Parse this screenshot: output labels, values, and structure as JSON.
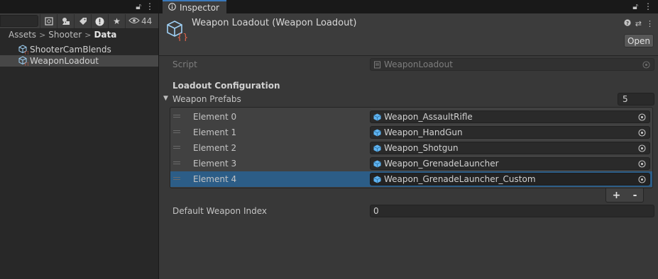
{
  "project": {
    "hidden_count": "44",
    "breadcrumb": [
      "Assets",
      "Shooter",
      "Data"
    ],
    "breadcrumb_sep": ">",
    "files": [
      {
        "name": "ShooterCamBlends",
        "selected": false
      },
      {
        "name": "WeaponLoadout",
        "selected": true
      }
    ]
  },
  "inspector": {
    "tab_label": "Inspector",
    "header_title": "Weapon Loadout (Weapon Loadout)",
    "open_label": "Open",
    "script_label": "Script",
    "script_value": "WeaponLoadout",
    "section_title": "Loadout Configuration",
    "list_label": "Weapon Prefabs",
    "list_count": "5",
    "elements": [
      {
        "label": "Element 0",
        "value": "Weapon_AssaultRifle"
      },
      {
        "label": "Element 1",
        "value": "Weapon_HandGun"
      },
      {
        "label": "Element 2",
        "value": "Weapon_Shotgun"
      },
      {
        "label": "Element 3",
        "value": "Weapon_GrenadeLauncher"
      },
      {
        "label": "Element 4",
        "value": "Weapon_GrenadeLauncher_Custom"
      }
    ],
    "selected_element": 4,
    "add_label": "+",
    "remove_label": "-",
    "default_index_label": "Default Weapon Index",
    "default_index_value": "0"
  },
  "colors": {
    "accent": "#3a79bb",
    "selection": "#2c5d87",
    "prefab_icon": "#5fb3f0",
    "so_icon_bracket": "#e0634a"
  },
  "icons": [
    "lock-icon",
    "kebab-menu-icon",
    "search-icon",
    "filter-by-type-icon",
    "label-icon",
    "warning-icon",
    "star-icon",
    "eye-icon",
    "scriptable-object-icon",
    "help-icon",
    "preset-icon",
    "prefab-cube-icon",
    "object-picker-icon",
    "script-file-icon",
    "foldout-arrow-icon",
    "drag-handle-icon"
  ]
}
